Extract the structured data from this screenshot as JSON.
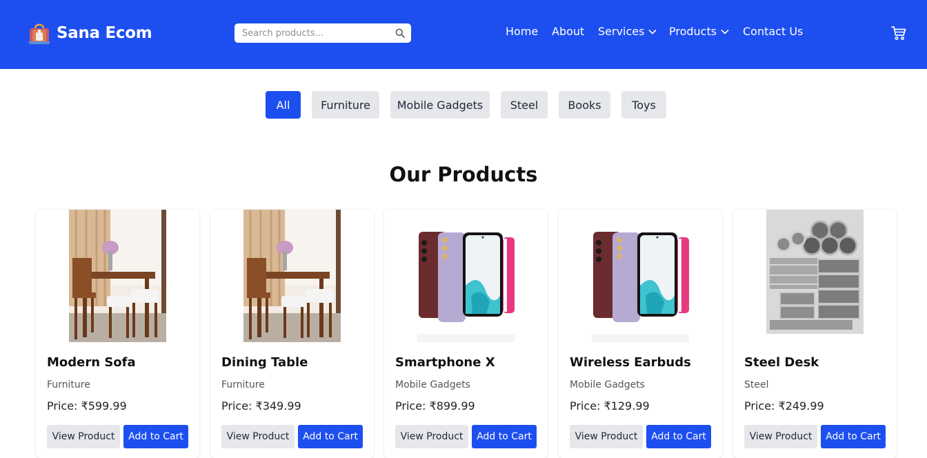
{
  "brand": {
    "name": "Sana Ecom",
    "logo_icon": "shopping-bag-icon"
  },
  "search": {
    "placeholder": "Search products...",
    "value": "",
    "icon": "search-icon"
  },
  "nav": {
    "home": "Home",
    "about": "About",
    "services": "Services",
    "products": "Products",
    "contact": "Contact Us",
    "cart_icon": "cart-icon"
  },
  "filters": [
    "All",
    "Furniture",
    "Mobile Gadgets",
    "Steel",
    "Books",
    "Toys"
  ],
  "active_filter": "All",
  "section_title": "Our Products",
  "products": [
    {
      "name": "Modern Sofa",
      "category": "Furniture",
      "price": "Price: ₹599.99",
      "image": "dining-set-image"
    },
    {
      "name": "Dining Table",
      "category": "Furniture",
      "price": "Price: ₹349.99",
      "image": "dining-set-image"
    },
    {
      "name": "Smartphone X",
      "category": "Mobile Gadgets",
      "price": "Price: ₹899.99",
      "image": "smartphones-image"
    },
    {
      "name": "Wireless Earbuds",
      "category": "Mobile Gadgets",
      "price": "Price: ₹129.99",
      "image": "smartphones-image"
    },
    {
      "name": "Steel Desk",
      "category": "Steel",
      "price": "Price: ₹249.99",
      "image": "steel-pipes-image"
    }
  ],
  "card_buttons": {
    "view": "View Product",
    "add": "Add to Cart"
  },
  "colors": {
    "primary": "#1d4ff0",
    "chip_bg": "#e5e7eb",
    "text": "#111827"
  }
}
